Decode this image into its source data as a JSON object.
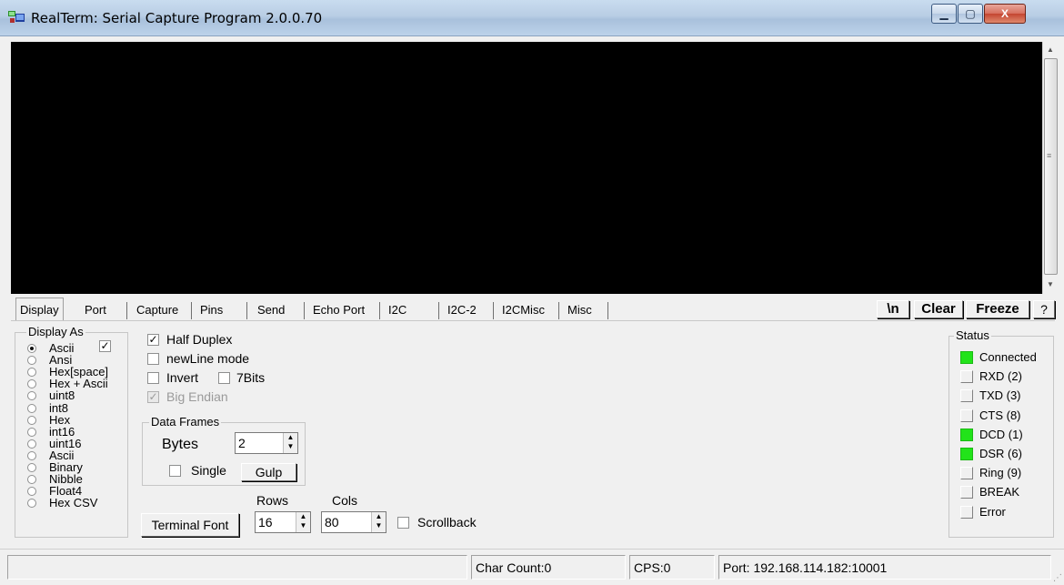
{
  "window": {
    "title": "RealTerm: Serial Capture Program 2.0.0.70",
    "minimize": "▁",
    "maximize": "▢",
    "close": "X"
  },
  "tabs": [
    "Display",
    "Port",
    "Capture",
    "Pins",
    "Send",
    "Echo Port",
    "I2C",
    "I2C-2",
    "I2CMisc",
    "Misc"
  ],
  "toolbar": {
    "newline_button": "\\n",
    "clear_button": "Clear",
    "freeze_button": "Freeze",
    "help_button": "?"
  },
  "display_as": {
    "title": "Display As",
    "options": [
      "Ascii",
      "Ansi",
      "Hex[space]",
      "Hex + Ascii",
      "uint8",
      "int8",
      "Hex",
      "int16",
      "uint16",
      "Ascii",
      "Binary",
      "Nibble",
      "Float4",
      "Hex CSV"
    ],
    "selected": "Ascii",
    "checkbox_checked": true
  },
  "options": {
    "half_duplex": "Half Duplex",
    "half_duplex_checked": true,
    "newline_mode": "newLine mode",
    "invert": "Invert",
    "seven_bits": "7Bits",
    "big_endian": "Big Endian",
    "big_endian_checked": true
  },
  "data_frames": {
    "title": "Data Frames",
    "bytes_label": "Bytes",
    "bytes_value": "2",
    "single_label": "Single",
    "gulp_button": "Gulp"
  },
  "terminal": {
    "font_button": "Terminal Font",
    "rows_label": "Rows",
    "rows_value": "16",
    "cols_label": "Cols",
    "cols_value": "80",
    "scrollback_label": "Scrollback"
  },
  "status": {
    "title": "Status",
    "on_color": "#22e31a",
    "items": [
      {
        "label": "Connected",
        "on": true
      },
      {
        "label": "RXD (2)",
        "on": false
      },
      {
        "label": "TXD (3)",
        "on": false
      },
      {
        "label": "CTS (8)",
        "on": false
      },
      {
        "label": "DCD (1)",
        "on": true
      },
      {
        "label": "DSR (6)",
        "on": true
      },
      {
        "label": "Ring (9)",
        "on": false
      },
      {
        "label": "BREAK",
        "on": false
      },
      {
        "label": "Error",
        "on": false
      }
    ]
  },
  "statusbar": {
    "char_count": "Char Count:0",
    "cps": "CPS:0",
    "port": "Port: 192.168.114.182:10001"
  }
}
